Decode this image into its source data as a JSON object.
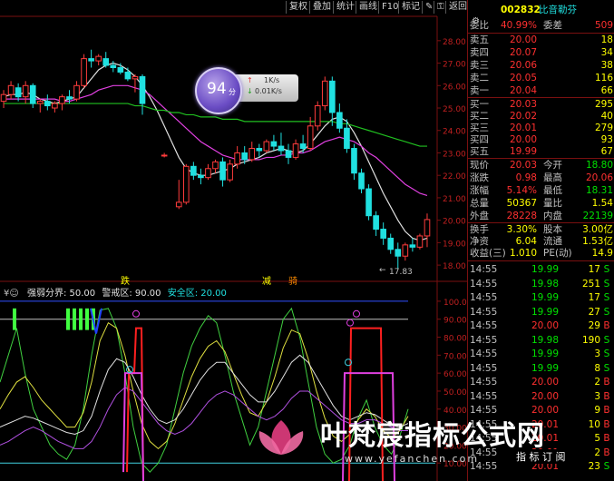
{
  "toolbar": {
    "buttons": [
      "复权",
      "叠加",
      "统计",
      "画线",
      "F10",
      "标记",
      "返回"
    ],
    "icon_labels": [
      "pencil-icon",
      "lock-icon",
      "settings-icon"
    ]
  },
  "header": {
    "code": "002832",
    "name": "比音勒芬",
    "weibi_label": "委比",
    "weibi_value": "40.99%",
    "weicha_label": "委差",
    "weicha_value": "509"
  },
  "asks": [
    {
      "label": "卖五",
      "price": "20.00",
      "vol": "18"
    },
    {
      "label": "卖四",
      "price": "20.07",
      "vol": "34"
    },
    {
      "label": "卖三",
      "price": "20.06",
      "vol": "38"
    },
    {
      "label": "卖二",
      "price": "20.05",
      "vol": "116"
    },
    {
      "label": "卖一",
      "price": "20.04",
      "vol": "66"
    }
  ],
  "bids": [
    {
      "label": "买一",
      "price": "20.03",
      "vol": "295"
    },
    {
      "label": "买二",
      "price": "20.02",
      "vol": "40"
    },
    {
      "label": "买三",
      "price": "20.01",
      "vol": "279"
    },
    {
      "label": "买四",
      "price": "20.00",
      "vol": "93"
    },
    {
      "label": "买五",
      "price": "19.99",
      "vol": "67"
    }
  ],
  "quote": [
    {
      "l1": "现价",
      "v1": "20.03",
      "l2": "今开",
      "v2": "18.80",
      "c1": "#ff3030",
      "c2": "#00e000"
    },
    {
      "l1": "涨跌",
      "v1": "0.98",
      "l2": "最高",
      "v2": "20.06",
      "c1": "#ff3030",
      "c2": "#ff3030"
    },
    {
      "l1": "涨幅",
      "v1": "5.14%",
      "l2": "最低",
      "v2": "18.31",
      "c1": "#ff3030",
      "c2": "#00e000"
    },
    {
      "l1": "总量",
      "v1": "50367",
      "l2": "量比",
      "v2": "1.54",
      "c1": "#ffff00",
      "c2": "#ffff00"
    },
    {
      "l1": "外盘",
      "v1": "28228",
      "l2": "内盘",
      "v2": "22139",
      "c1": "#ff3030",
      "c2": "#00e000"
    }
  ],
  "stats": [
    {
      "l1": "换手",
      "v1": "3.30%",
      "l2": "股本",
      "v2": "3.00亿"
    },
    {
      "l1": "净资",
      "v1": "6.04",
      "l2": "流通",
      "v2": "1.53亿"
    },
    {
      "l1": "收益(三)",
      "v1": "1.010",
      "l2": "PE(动)",
      "v2": "14.9"
    }
  ],
  "ticks": [
    {
      "time": "14:55",
      "price": "19.99",
      "vol": "17",
      "side": "S"
    },
    {
      "time": "14:55",
      "price": "19.98",
      "vol": "251",
      "side": "S"
    },
    {
      "time": "14:55",
      "price": "19.99",
      "vol": "17",
      "side": "S"
    },
    {
      "time": "14:55",
      "price": "19.99",
      "vol": "27",
      "side": "S"
    },
    {
      "time": "14:55",
      "price": "20.00",
      "vol": "29",
      "side": "B"
    },
    {
      "time": "14:55",
      "price": "19.98",
      "vol": "190",
      "side": "S"
    },
    {
      "time": "14:55",
      "price": "19.99",
      "vol": "3",
      "side": "S"
    },
    {
      "time": "14:55",
      "price": "19.99",
      "vol": "8",
      "side": "S"
    },
    {
      "time": "14:55",
      "price": "20.00",
      "vol": "2",
      "side": "B"
    },
    {
      "time": "14:55",
      "price": "20.00",
      "vol": "3",
      "side": "B"
    },
    {
      "time": "14:55",
      "price": "20.00",
      "vol": "9",
      "side": "B"
    },
    {
      "time": "14:55",
      "price": "20.01",
      "vol": "10",
      "side": "B"
    },
    {
      "time": "14:55",
      "price": "20.01",
      "vol": "5",
      "side": "B"
    },
    {
      "time": "14:55",
      "price": "20.01",
      "vol": "2",
      "side": "B"
    },
    {
      "time": "14:55",
      "price": "20.01",
      "vol": "23",
      "side": "S"
    }
  ],
  "price_chart": {
    "y_ticks": [
      "28.00",
      "27.00",
      "26.00",
      "25.00",
      "24.00",
      "23.00",
      "22.00",
      "21.00",
      "20.00",
      "19.00",
      "18.00"
    ],
    "low_marker": "17.83",
    "markers": [
      "跌",
      "减",
      "骑"
    ]
  },
  "badge": {
    "score": "94",
    "unit": "分",
    "up_speed": "1K/s",
    "down_speed": "0.01K/s"
  },
  "indicator": {
    "legend": [
      "¥☺",
      "强弱分界: 50.00",
      "警戒区: 90.00",
      "安全区: 20.00"
    ],
    "y_ticks": [
      "100.0",
      "90.00",
      "80.00",
      "70.00",
      "60.00",
      "50.00",
      "40.00",
      "30.00",
      "20.00",
      "10.00"
    ]
  },
  "watermark": {
    "title": "叶梵宸指标公式网",
    "url": "www.yefanchen.com",
    "slogan": "指 标 订 阅"
  },
  "chart_data": {
    "type": "candlestick",
    "ylim": [
      17.6,
      28.6
    ],
    "low_value": 17.83,
    "candles": [
      {
        "o": 25.3,
        "h": 25.8,
        "l": 25.0,
        "c": 25.6
      },
      {
        "o": 25.6,
        "h": 26.2,
        "l": 25.4,
        "c": 26.0
      },
      {
        "o": 25.9,
        "h": 26.1,
        "l": 25.3,
        "c": 25.5
      },
      {
        "o": 25.5,
        "h": 26.2,
        "l": 25.2,
        "c": 26.0
      },
      {
        "o": 26.0,
        "h": 26.1,
        "l": 25.0,
        "c": 25.2
      },
      {
        "o": 25.2,
        "h": 25.4,
        "l": 24.8,
        "c": 25.3
      },
      {
        "o": 25.3,
        "h": 25.6,
        "l": 24.9,
        "c": 25.1
      },
      {
        "o": 25.0,
        "h": 25.3,
        "l": 24.8,
        "c": 25.2
      },
      {
        "o": 25.2,
        "h": 25.6,
        "l": 24.9,
        "c": 25.5
      },
      {
        "o": 25.5,
        "h": 25.8,
        "l": 25.2,
        "c": 25.4
      },
      {
        "o": 25.4,
        "h": 26.2,
        "l": 25.3,
        "c": 26.0
      },
      {
        "o": 26.0,
        "h": 27.4,
        "l": 25.9,
        "c": 27.2
      },
      {
        "o": 27.2,
        "h": 27.6,
        "l": 26.8,
        "c": 27.1
      },
      {
        "o": 27.1,
        "h": 27.4,
        "l": 26.9,
        "c": 27.3
      },
      {
        "o": 27.2,
        "h": 27.5,
        "l": 26.8,
        "c": 26.9
      },
      {
        "o": 26.9,
        "h": 27.1,
        "l": 26.6,
        "c": 26.8
      },
      {
        "o": 26.8,
        "h": 27.0,
        "l": 26.5,
        "c": 26.6
      },
      {
        "o": 26.6,
        "h": 26.8,
        "l": 26.2,
        "c": 26.3
      },
      {
        "o": 26.3,
        "h": 26.5,
        "l": 25.7,
        "c": 26.4
      },
      {
        "o": 26.4,
        "h": 26.5,
        "l": 24.7,
        "c": 25.2
      },
      {
        "o": null,
        "h": null,
        "l": null,
        "c": null
      },
      {
        "o": null,
        "h": null,
        "l": null,
        "c": null
      },
      {
        "o": 22.9,
        "h": 23.0,
        "l": 22.8,
        "c": 22.9
      },
      {
        "o": null,
        "h": null,
        "l": null,
        "c": null
      },
      {
        "o": 20.6,
        "h": 21.8,
        "l": 20.5,
        "c": 20.8
      },
      {
        "o": 20.8,
        "h": 22.5,
        "l": 20.7,
        "c": 22.4
      },
      {
        "o": 22.4,
        "h": 22.6,
        "l": 21.8,
        "c": 22.0
      },
      {
        "o": 22.0,
        "h": 22.3,
        "l": 21.6,
        "c": 21.9
      },
      {
        "o": 21.9,
        "h": 22.5,
        "l": 21.8,
        "c": 22.3
      },
      {
        "o": 22.3,
        "h": 22.7,
        "l": 22.1,
        "c": 22.6
      },
      {
        "o": 22.6,
        "h": 22.8,
        "l": 21.5,
        "c": 21.8
      },
      {
        "o": 21.8,
        "h": 22.7,
        "l": 21.7,
        "c": 22.5
      },
      {
        "o": 22.5,
        "h": 23.3,
        "l": 22.3,
        "c": 23.0
      },
      {
        "o": 23.0,
        "h": 23.3,
        "l": 22.5,
        "c": 22.7
      },
      {
        "o": 22.7,
        "h": 23.5,
        "l": 22.6,
        "c": 23.2
      },
      {
        "o": 23.2,
        "h": 23.4,
        "l": 22.8,
        "c": 23.1
      },
      {
        "o": 23.1,
        "h": 23.6,
        "l": 23.0,
        "c": 23.5
      },
      {
        "o": 23.5,
        "h": 23.8,
        "l": 23.1,
        "c": 23.3
      },
      {
        "o": 23.3,
        "h": 23.9,
        "l": 22.9,
        "c": 23.1
      },
      {
        "o": 23.1,
        "h": 23.4,
        "l": 22.5,
        "c": 22.8
      },
      {
        "o": 22.8,
        "h": 23.6,
        "l": 22.7,
        "c": 23.4
      },
      {
        "o": 23.4,
        "h": 23.8,
        "l": 23.0,
        "c": 23.2
      },
      {
        "o": 23.2,
        "h": 24.6,
        "l": 23.1,
        "c": 24.2
      },
      {
        "o": 24.2,
        "h": 25.3,
        "l": 24.0,
        "c": 25.1
      },
      {
        "o": 25.1,
        "h": 26.4,
        "l": 24.9,
        "c": 26.2
      },
      {
        "o": 26.2,
        "h": 26.4,
        "l": 24.2,
        "c": 24.8
      },
      {
        "o": 24.8,
        "h": 25.2,
        "l": 23.9,
        "c": 24.1
      },
      {
        "o": 24.1,
        "h": 24.5,
        "l": 23.0,
        "c": 23.2
      },
      {
        "o": 23.2,
        "h": 23.4,
        "l": 21.8,
        "c": 22.1
      },
      {
        "o": 22.1,
        "h": 22.3,
        "l": 21.2,
        "c": 21.4
      },
      {
        "o": 21.4,
        "h": 21.6,
        "l": 20.0,
        "c": 20.2
      },
      {
        "o": 20.2,
        "h": 20.4,
        "l": 19.3,
        "c": 19.6
      },
      {
        "o": 19.6,
        "h": 19.9,
        "l": 18.9,
        "c": 19.2
      },
      {
        "o": 19.2,
        "h": 19.4,
        "l": 18.5,
        "c": 18.7
      },
      {
        "o": 18.7,
        "h": 19.0,
        "l": 17.83,
        "c": 18.4
      },
      {
        "o": 18.4,
        "h": 19.0,
        "l": 18.2,
        "c": 18.9
      },
      {
        "o": 18.9,
        "h": 19.2,
        "l": 18.6,
        "c": 18.8
      },
      {
        "o": 18.8,
        "h": 19.4,
        "l": 18.7,
        "c": 19.3
      },
      {
        "o": 19.3,
        "h": 20.3,
        "l": 18.8,
        "c": 20.03
      }
    ],
    "ma_series": [
      {
        "color": "#e0e0e0",
        "values": [
          25.5,
          25.6,
          25.6,
          25.7,
          25.6,
          25.4,
          25.3,
          25.2,
          25.3,
          25.4,
          25.5,
          25.9,
          26.3,
          26.7,
          26.9,
          27.0,
          26.9,
          26.7,
          26.4,
          26.0,
          25.5,
          24.9,
          24.2,
          23.5,
          22.8,
          22.3,
          22.1,
          22.0,
          22.0,
          22.1,
          22.2,
          22.3,
          22.5,
          22.6,
          22.7,
          22.8,
          23.0,
          23.1,
          23.2,
          23.1,
          23.0,
          23.1,
          23.4,
          23.8,
          24.2,
          24.5,
          24.6,
          24.4,
          23.9,
          23.3,
          22.6,
          21.9,
          21.2,
          20.6,
          20.0,
          19.5,
          19.2,
          19.1,
          19.2
        ]
      },
      {
        "color": "#e040e0",
        "values": [
          25.4,
          25.4,
          25.4,
          25.4,
          25.4,
          25.4,
          25.4,
          25.4,
          25.3,
          25.3,
          25.4,
          25.5,
          25.6,
          25.8,
          25.9,
          26.0,
          26.0,
          26.0,
          25.9,
          25.8,
          25.6,
          25.3,
          25.0,
          24.7,
          24.4,
          24.1,
          23.8,
          23.5,
          23.3,
          23.1,
          22.9,
          22.8,
          22.7,
          22.7,
          22.7,
          22.7,
          22.8,
          22.8,
          22.9,
          22.9,
          23.0,
          23.0,
          23.1,
          23.3,
          23.5,
          23.6,
          23.7,
          23.6,
          23.5,
          23.3,
          23.0,
          22.8,
          22.5,
          22.2,
          21.9,
          21.6,
          21.4,
          21.2,
          21.1
        ]
      },
      {
        "color": "#20c020",
        "values": [
          25.2,
          25.2,
          25.2,
          25.2,
          25.2,
          25.2,
          25.2,
          25.2,
          25.2,
          25.2,
          25.2,
          25.2,
          25.2,
          25.2,
          25.2,
          25.2,
          25.2,
          25.2,
          25.1,
          25.1,
          25.0,
          24.9,
          24.9,
          24.8,
          24.8,
          24.7,
          24.7,
          24.6,
          24.6,
          24.6,
          24.5,
          24.5,
          24.5,
          24.4,
          24.4,
          24.4,
          24.4,
          24.4,
          24.4,
          24.4,
          24.4,
          24.4,
          24.4,
          24.4,
          24.4,
          24.4,
          24.3,
          24.3,
          24.2,
          24.1,
          24.0,
          23.9,
          23.8,
          23.7,
          23.6,
          23.5,
          23.4,
          23.3,
          23.3
        ]
      }
    ],
    "indicator_ylim": [
      0,
      105
    ],
    "indicator_lines": [
      {
        "name": "强弱分界",
        "value": 50.0
      },
      {
        "name": "警戒区",
        "value": 90.0
      },
      {
        "name": "安全区",
        "value": 20.0
      }
    ]
  }
}
